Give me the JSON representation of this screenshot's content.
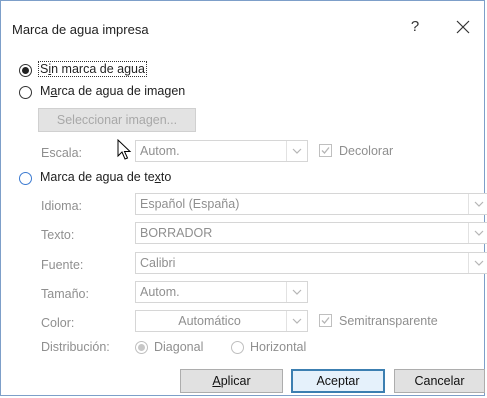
{
  "dialog": {
    "title": "Marca de agua impresa",
    "help_label": "?"
  },
  "options": {
    "none_label_prefix": "S",
    "none_label_underlined": "i",
    "none_label_rest": "n marca de agua",
    "picture_label_prefix": "M",
    "picture_label_underlined": "a",
    "picture_label_rest": "rca de agua de imagen",
    "text_label_prefix": "Marca de agua de te",
    "text_label_underlined": "x",
    "text_label_rest": "to"
  },
  "picture": {
    "select_button": "Seleccionar imagen...",
    "scale_label": "Escala:",
    "scale_value": "Autom.",
    "washout_label": "Decolorar"
  },
  "text_wm": {
    "language_label": "Idioma:",
    "language_value": "Español (España)",
    "text_label": "Texto:",
    "text_value": "BORRADOR",
    "font_label": "Fuente:",
    "font_value": "Calibri",
    "size_label": "Tamaño:",
    "size_value": "Autom.",
    "color_label": "Color:",
    "color_value": "Automático",
    "semitransparent_label": "Semitransparente",
    "layout_label": "Distribución:",
    "diagonal_label": "Diagonal",
    "horizontal_label": "Horizontal"
  },
  "buttons": {
    "apply_underlined": "A",
    "apply_rest": "plicar",
    "ok": "Aceptar",
    "cancel": "Cancelar"
  }
}
